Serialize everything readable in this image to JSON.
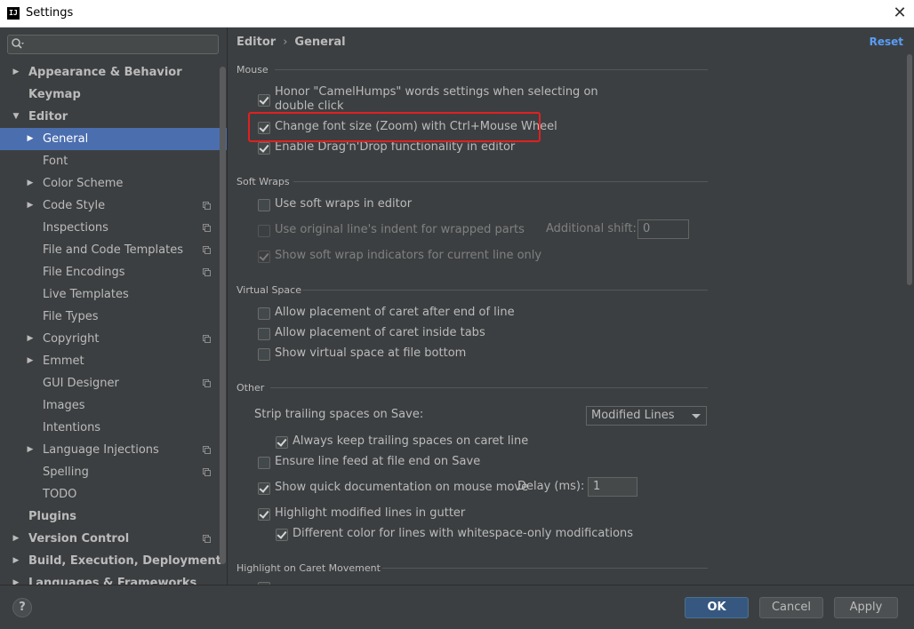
{
  "window": {
    "title": "Settings",
    "close_glyph": "✕"
  },
  "sidebar": {
    "search_placeholder": "",
    "items": [
      {
        "label": "Appearance & Behavior",
        "level": 0,
        "bold": true,
        "arrow": "▶",
        "project": false
      },
      {
        "label": "Keymap",
        "level": 0,
        "bold": true,
        "arrow": "",
        "project": false
      },
      {
        "label": "Editor",
        "level": 0,
        "bold": true,
        "arrow": "▼",
        "project": false
      },
      {
        "label": "General",
        "level": 1,
        "bold": false,
        "arrow": "▶",
        "project": false,
        "selected": true
      },
      {
        "label": "Font",
        "level": 1,
        "bold": false,
        "arrow": "",
        "project": false
      },
      {
        "label": "Color Scheme",
        "level": 1,
        "bold": false,
        "arrow": "▶",
        "project": false
      },
      {
        "label": "Code Style",
        "level": 1,
        "bold": false,
        "arrow": "▶",
        "project": true
      },
      {
        "label": "Inspections",
        "level": 1,
        "bold": false,
        "arrow": "",
        "project": true
      },
      {
        "label": "File and Code Templates",
        "level": 1,
        "bold": false,
        "arrow": "",
        "project": true
      },
      {
        "label": "File Encodings",
        "level": 1,
        "bold": false,
        "arrow": "",
        "project": true
      },
      {
        "label": "Live Templates",
        "level": 1,
        "bold": false,
        "arrow": "",
        "project": false
      },
      {
        "label": "File Types",
        "level": 1,
        "bold": false,
        "arrow": "",
        "project": false
      },
      {
        "label": "Copyright",
        "level": 1,
        "bold": false,
        "arrow": "▶",
        "project": true
      },
      {
        "label": "Emmet",
        "level": 1,
        "bold": false,
        "arrow": "▶",
        "project": false
      },
      {
        "label": "GUI Designer",
        "level": 1,
        "bold": false,
        "arrow": "",
        "project": true
      },
      {
        "label": "Images",
        "level": 1,
        "bold": false,
        "arrow": "",
        "project": false
      },
      {
        "label": "Intentions",
        "level": 1,
        "bold": false,
        "arrow": "",
        "project": false
      },
      {
        "label": "Language Injections",
        "level": 1,
        "bold": false,
        "arrow": "▶",
        "project": true
      },
      {
        "label": "Spelling",
        "level": 1,
        "bold": false,
        "arrow": "",
        "project": true
      },
      {
        "label": "TODO",
        "level": 1,
        "bold": false,
        "arrow": "",
        "project": false
      },
      {
        "label": "Plugins",
        "level": 0,
        "bold": true,
        "arrow": "",
        "project": false
      },
      {
        "label": "Version Control",
        "level": 0,
        "bold": true,
        "arrow": "▶",
        "project": true
      },
      {
        "label": "Build, Execution, Deployment",
        "level": 0,
        "bold": true,
        "arrow": "▶",
        "project": false
      },
      {
        "label": "Languages & Frameworks",
        "level": 0,
        "bold": true,
        "arrow": "▶",
        "project": false
      }
    ]
  },
  "content": {
    "breadcrumb": {
      "parent": "Editor",
      "separator": "›",
      "current": "General"
    },
    "reset_label": "Reset",
    "sections": {
      "mouse": "Mouse",
      "soft_wraps": "Soft Wraps",
      "virtual_space": "Virtual Space",
      "other": "Other",
      "highlight_caret": "Highlight on Caret Movement"
    },
    "mouse": {
      "camel_humps_line1": "Honor \"CamelHumps\" words settings when selecting on",
      "camel_humps_line2": "double click",
      "zoom": "Change font size (Zoom) with Ctrl+Mouse Wheel",
      "drag_drop": "Enable Drag'n'Drop functionality in editor"
    },
    "soft_wraps": {
      "use_soft_wraps": "Use soft wraps in editor",
      "original_indent": "Use original line's indent for wrapped parts",
      "additional_shift_label": "Additional shift:",
      "additional_shift_value": "0",
      "show_indicators": "Show soft wrap indicators for current line only"
    },
    "virtual_space": {
      "after_end": "Allow placement of caret after end of line",
      "inside_tabs": "Allow placement of caret inside tabs",
      "file_bottom": "Show virtual space at file bottom"
    },
    "other": {
      "strip_label": "Strip trailing spaces on Save:",
      "strip_value": "Modified Lines",
      "keep_trailing": "Always keep trailing spaces on caret line",
      "line_feed": "Ensure line feed at file end on Save",
      "quick_doc": "Show quick documentation on mouse move",
      "delay_label": "Delay (ms):",
      "delay_value": "1",
      "highlight_modified": "Highlight modified lines in gutter",
      "different_color": "Different color for lines with whitespace-only modifications"
    }
  },
  "footer": {
    "help_glyph": "?",
    "ok_label": "OK",
    "cancel_label": "Cancel",
    "apply_label": "Apply"
  },
  "colors": {
    "background": "#3c3f41",
    "selection": "#4b6eaf",
    "primary_button": "#365880",
    "link": "#589df6",
    "annotation_red": "#e02020"
  }
}
